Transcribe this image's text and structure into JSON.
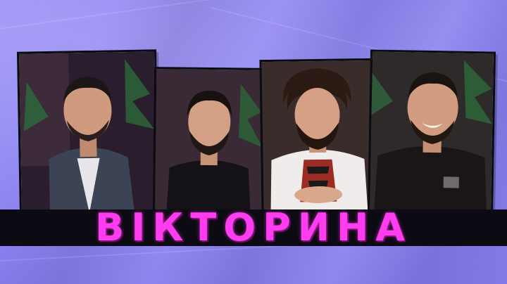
{
  "title": "ВІКТОРИНА",
  "colors": {
    "background": "#8f86f2",
    "title": "#ff3df0",
    "band": "#0c0a12"
  },
  "panels": [
    {
      "name": "person-1",
      "description_icon": "person-icon"
    },
    {
      "name": "person-2",
      "description_icon": "person-icon"
    },
    {
      "name": "person-3",
      "description_icon": "person-icon"
    },
    {
      "name": "person-4",
      "description_icon": "person-icon"
    }
  ]
}
